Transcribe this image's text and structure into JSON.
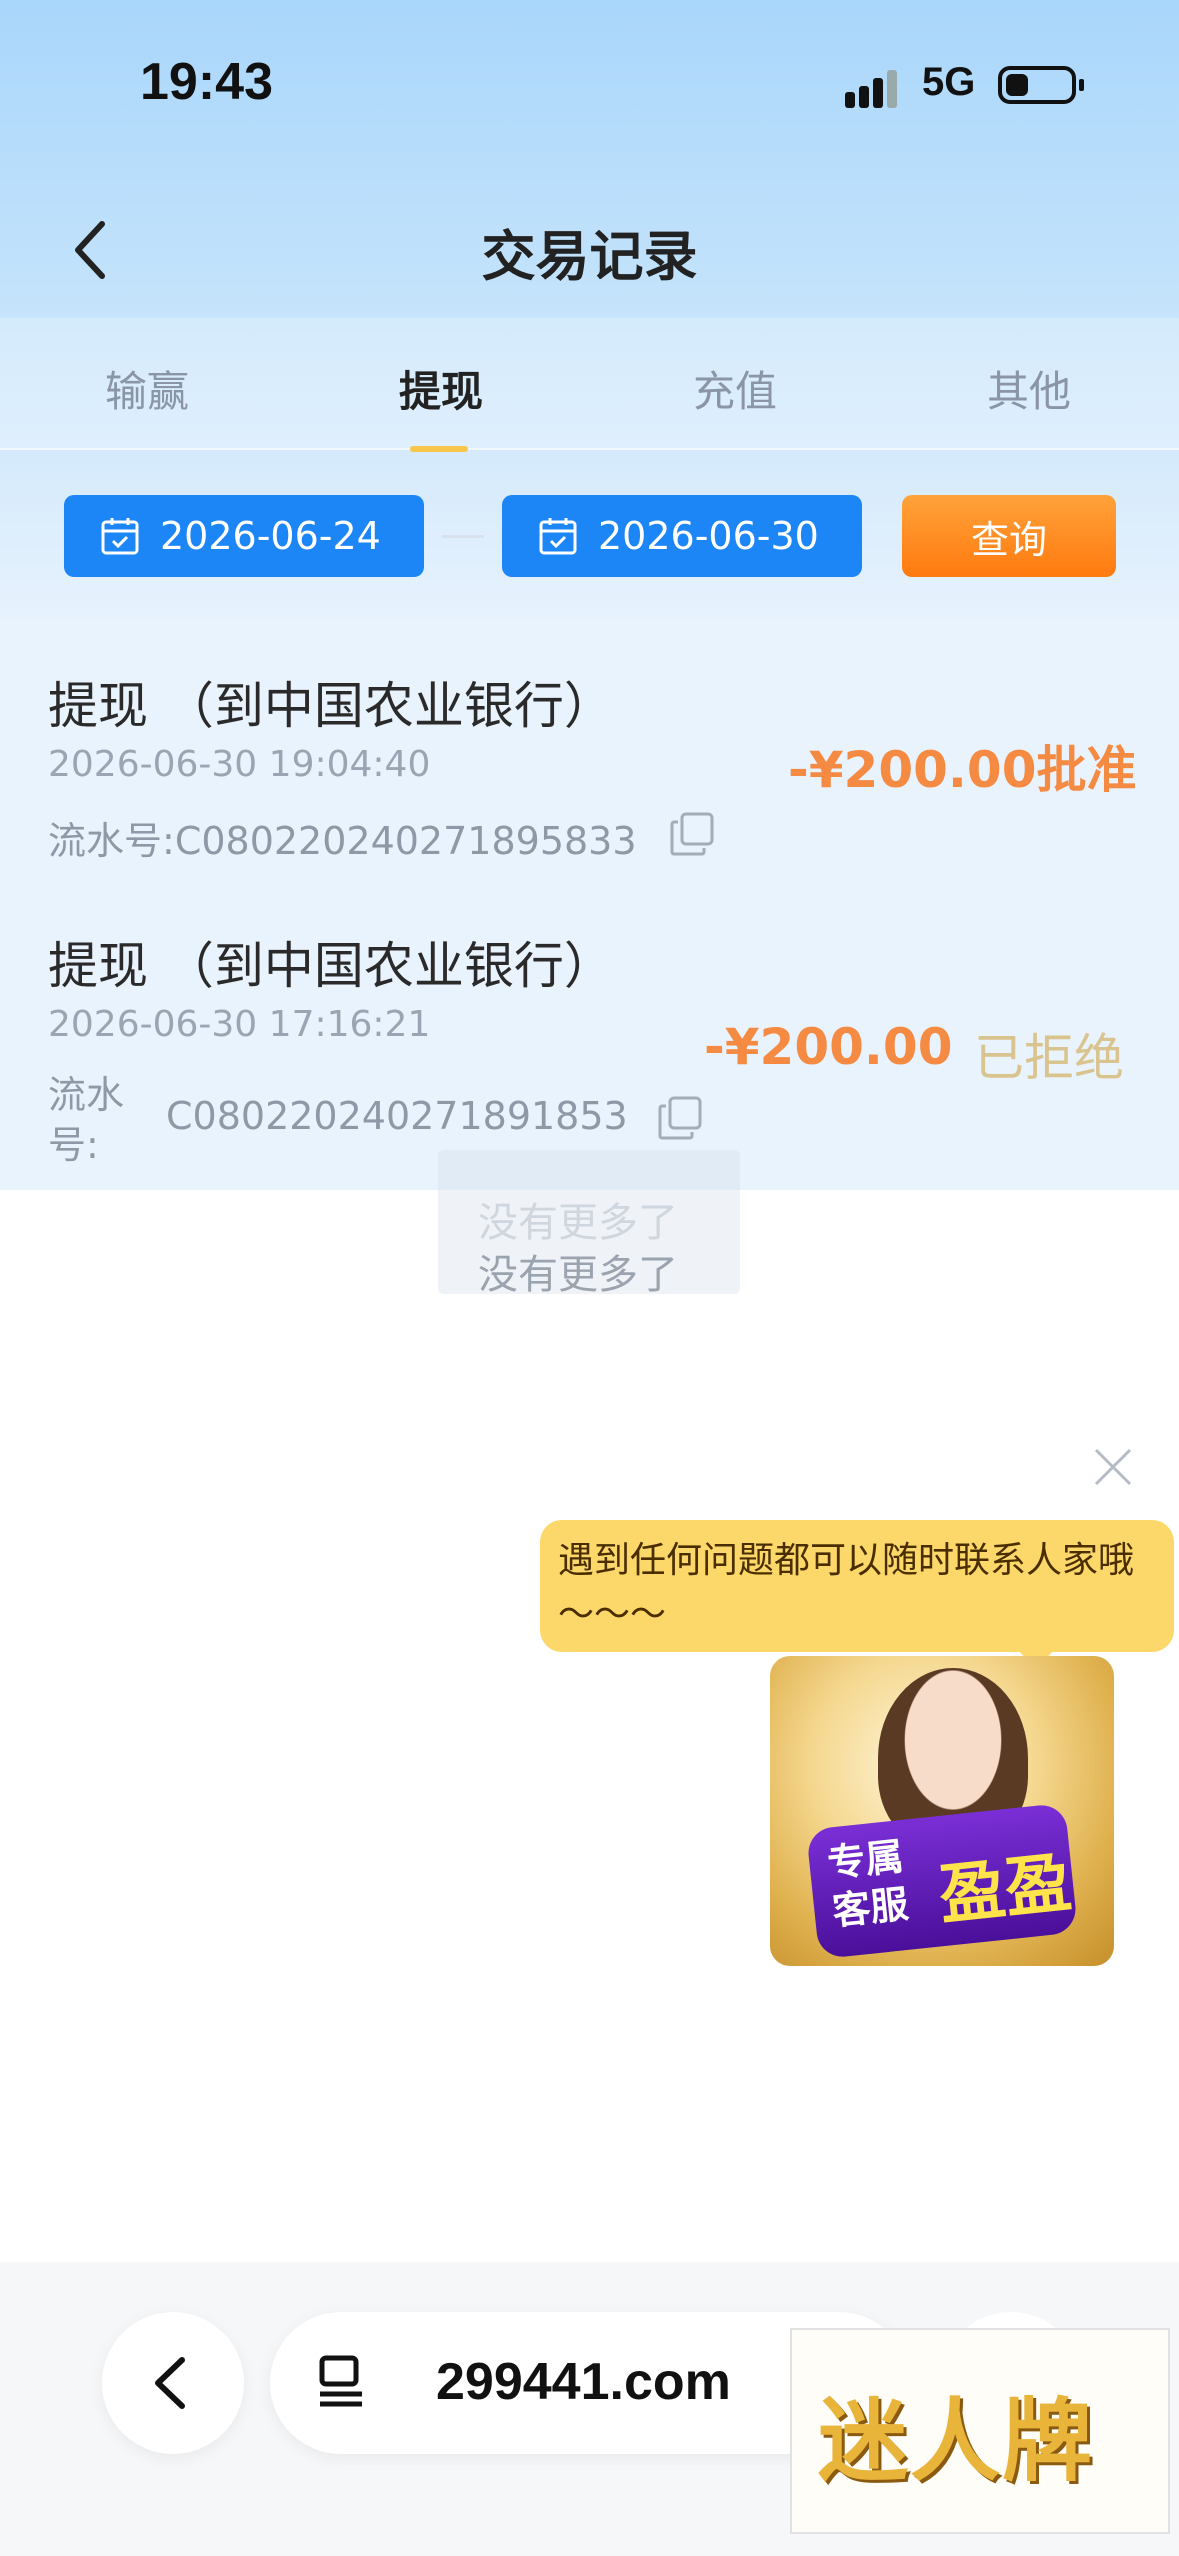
{
  "status_bar": {
    "time": "19:43",
    "network": "5G",
    "battery_level": 0.35
  },
  "header": {
    "title": "交易记录"
  },
  "tabs": [
    {
      "label": "输赢",
      "active": false
    },
    {
      "label": "提现",
      "active": true
    },
    {
      "label": "充值",
      "active": false
    },
    {
      "label": "其他",
      "active": false
    }
  ],
  "filter": {
    "start_date": "2026-06-24",
    "end_date": "2026-06-30",
    "query_label": "查询"
  },
  "records": [
    {
      "title": "提现 （到中国农业银行）",
      "time": "2026-06-30 19:04:40",
      "serial_label": "流水号:",
      "serial": "C080220240271895833",
      "amount": "-¥200.00",
      "status": "批准",
      "status_color": "#f58a42"
    },
    {
      "title": "提现 （到中国农业银行）",
      "time": "2026-06-30 17:16:21",
      "serial_label_line1": "流水",
      "serial_label_line2": "号:",
      "serial": "C080220240271891853",
      "amount": "-¥200.00",
      "status": "已拒绝",
      "status_color": "#d9c48f"
    }
  ],
  "list_footer": "没有更多了",
  "service": {
    "bubble_text": "遇到任何问题都可以随时联系人家哦～～～",
    "badge_line1": "专属",
    "badge_line2": "客服",
    "badge_name": "盈盈"
  },
  "browser": {
    "url": "299441.com"
  },
  "ad": {
    "text": "迷人牌"
  },
  "colors": {
    "primary_blue": "#1d86f7",
    "orange": "#ff8a1f",
    "amount_orange": "#f58a42",
    "rejected_gold": "#d9c48f",
    "tab_indicator": "#f7c64a"
  }
}
